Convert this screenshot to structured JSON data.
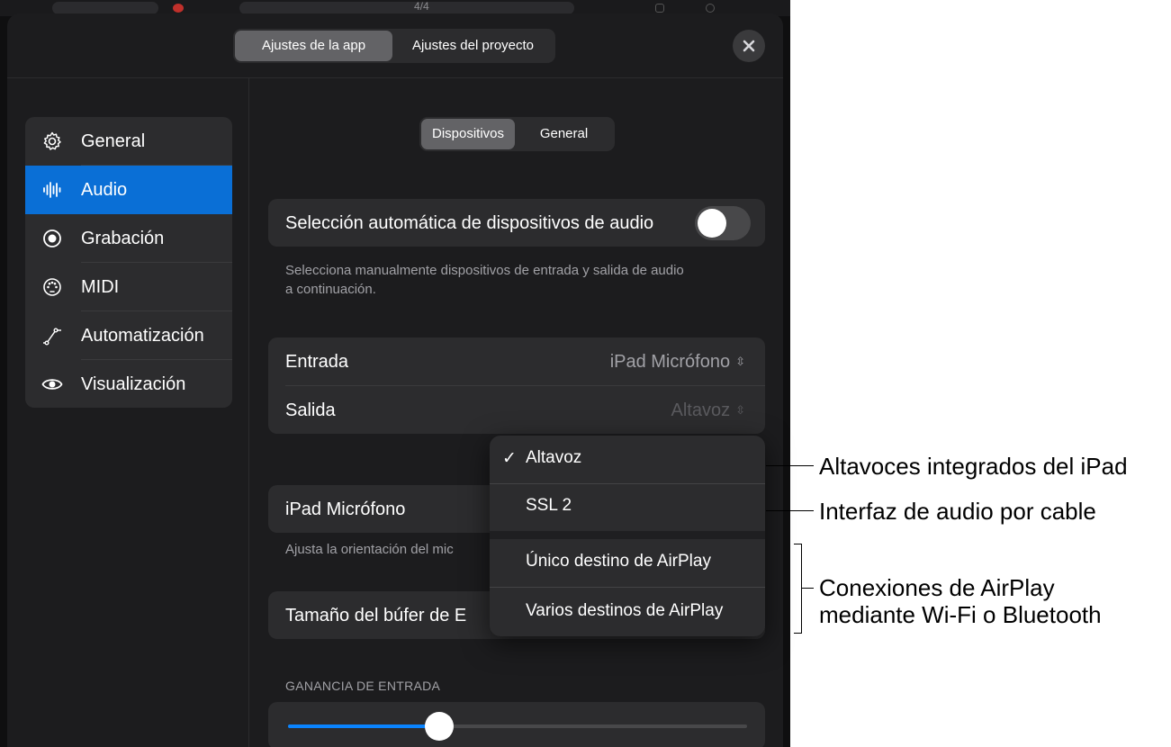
{
  "header": {
    "tabs": [
      {
        "label": "Ajustes de la app",
        "active": true
      },
      {
        "label": "Ajustes del proyecto",
        "active": false
      }
    ],
    "close_icon": "xmark-icon",
    "background_meter": "4/4"
  },
  "sidebar": {
    "items": [
      {
        "label": "General",
        "icon": "gear-icon",
        "active": false
      },
      {
        "label": "Audio",
        "icon": "waveform-icon",
        "active": true
      },
      {
        "label": "Grabación",
        "icon": "record-icon",
        "active": false
      },
      {
        "label": "MIDI",
        "icon": "midi-port-icon",
        "active": false
      },
      {
        "label": "Automatización",
        "icon": "automation-curve-icon",
        "active": false
      },
      {
        "label": "Visualización",
        "icon": "eye-icon",
        "active": false
      }
    ]
  },
  "content": {
    "tabs": [
      {
        "label": "Dispositivos",
        "active": true
      },
      {
        "label": "General",
        "active": false
      }
    ],
    "auto_select": {
      "label": "Selección automática de dispositivos de audio",
      "enabled": false,
      "footnote_line1": "Selecciona manualmente dispositivos de entrada y salida de audio",
      "footnote_line2": "a continuación."
    },
    "io": {
      "input_label": "Entrada",
      "input_value": "iPad Micrófono",
      "output_label": "Salida",
      "output_value": "Altavoz"
    },
    "mic": {
      "label": "iPad Micrófono",
      "footnote": "Ajusta la orientación del mic"
    },
    "buffer": {
      "label": "Tamaño del búfer de E"
    },
    "gain": {
      "header": "GANANCIA DE ENTRADA",
      "level_fraction": 0.33
    }
  },
  "popup": {
    "checkmark": "✓",
    "items": [
      {
        "label": "Altavoz",
        "checked": true
      },
      {
        "label": "SSL 2",
        "checked": false
      },
      {
        "label": "Único destino de AirPlay",
        "checked": false
      },
      {
        "label": "Varios destinos de AirPlay",
        "checked": false
      }
    ]
  },
  "callouts": {
    "builtin": "Altavoces integrados del iPad",
    "wired": "Interfaz de audio por cable",
    "airplay_line1": "Conexiones de AirPlay",
    "airplay_line2": "mediante Wi-Fi o Bluetooth"
  },
  "colors": {
    "accent": "#0a6fd6",
    "slider": "#0a84ff",
    "panel": "#1c1c1e",
    "card": "#2c2c2e",
    "secondary_text": "#a1a1a6"
  }
}
